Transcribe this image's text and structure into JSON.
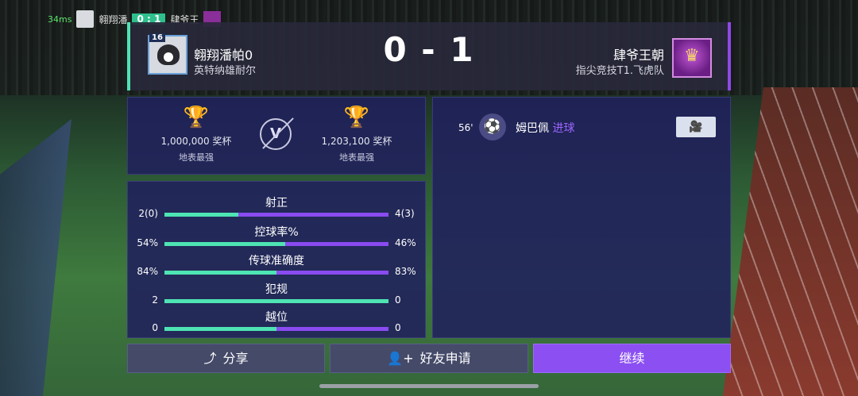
{
  "topbar": {
    "ping": "34ms",
    "player": "翱翔潘",
    "score": "0 : 1",
    "opponent": "肆爷王"
  },
  "header": {
    "home": {
      "level": "16",
      "name": "翱翔潘帕0",
      "club": "英特纳雄耐尔"
    },
    "score": "0 - 1",
    "away": {
      "name": "肆爷王朝",
      "club": "指尖竞技T1.飞虎队"
    }
  },
  "trophies": {
    "home": {
      "value": "1,000,000 奖杯",
      "league": "地表最强"
    },
    "vs": "V",
    "away": {
      "value": "1,203,100 奖杯",
      "league": "地表最强"
    }
  },
  "stats": [
    {
      "label": "射正",
      "left": "2(0)",
      "right": "4(3)",
      "home_share": 0.33
    },
    {
      "label": "控球率%",
      "left": "54%",
      "right": "46%",
      "home_share": 0.54
    },
    {
      "label": "传球准确度",
      "left": "84%",
      "right": "83%",
      "home_share": 0.5
    },
    {
      "label": "犯规",
      "left": "2",
      "right": "0",
      "home_share": 1.0
    },
    {
      "label": "越位",
      "left": "0",
      "right": "0",
      "home_share": 0.5
    }
  ],
  "events": [
    {
      "minute": "56'",
      "player": "姆巴佩",
      "type": "进球",
      "icon": "soccer-ball-icon"
    }
  ],
  "buttons": {
    "share": "分享",
    "friend": "好友申请",
    "continue": "继续"
  },
  "colors": {
    "home_accent": "#4ee4b3",
    "away_accent": "#8a4bf0",
    "continue_bg": "#8b4ff2"
  }
}
